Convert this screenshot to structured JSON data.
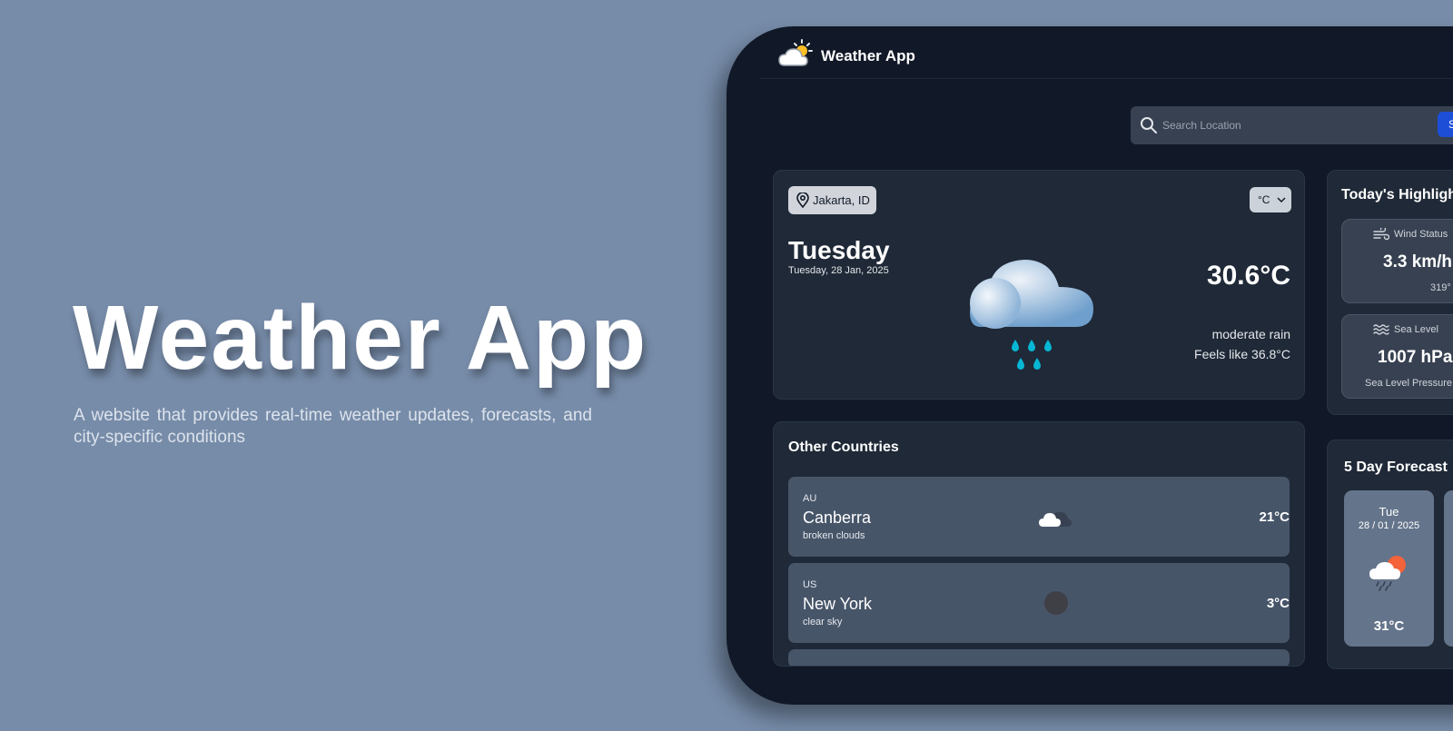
{
  "hero": {
    "title": "Weather App",
    "subtitle": "A website that provides real-time weather updates, forecasts, and city-specific conditions"
  },
  "navbar": {
    "app_name": "Weather App",
    "logo_icon": "sun-cloud-icon"
  },
  "search": {
    "placeholder": "Search Location",
    "value": "",
    "button_label": "Search"
  },
  "current": {
    "location": "Jakarta, ID",
    "unit": "°C",
    "day": "Tuesday",
    "date": "Tuesday, 28 Jan, 2025",
    "temperature": "30.6°C",
    "condition": "moderate rain",
    "feels_like": "Feels like 36.8°C",
    "icon": "rain-cloud-icon"
  },
  "highlights": {
    "title": "Today's Highlights",
    "wind": {
      "label": "Wind Status",
      "value": "3.3 km/h",
      "sub": "319°",
      "icon": "wind-icon"
    },
    "sea": {
      "label": "Sea Level",
      "value": "1007 hPa",
      "sub": "Sea Level Pressure",
      "icon": "waves-icon"
    }
  },
  "countries": {
    "title": "Other Countries",
    "items": [
      {
        "code": "AU",
        "city": "Canberra",
        "description": "broken clouds",
        "temp": "21°C",
        "icon": "broken-clouds-icon"
      },
      {
        "code": "US",
        "city": "New York",
        "description": "clear sky",
        "temp": "3°C",
        "icon": "clear-night-icon"
      }
    ]
  },
  "forecast": {
    "title": "5 Day Forecast",
    "days": [
      {
        "day": "Tue",
        "date": "28 / 01 / 2025",
        "temp": "31°C",
        "icon": "sun-rain-icon"
      }
    ]
  },
  "colors": {
    "page_background": "#778ca9",
    "device_background": "#111827",
    "card_background": "#1f2937",
    "accent": "#1d4ed8",
    "rain_drop": "#06b6d4"
  }
}
